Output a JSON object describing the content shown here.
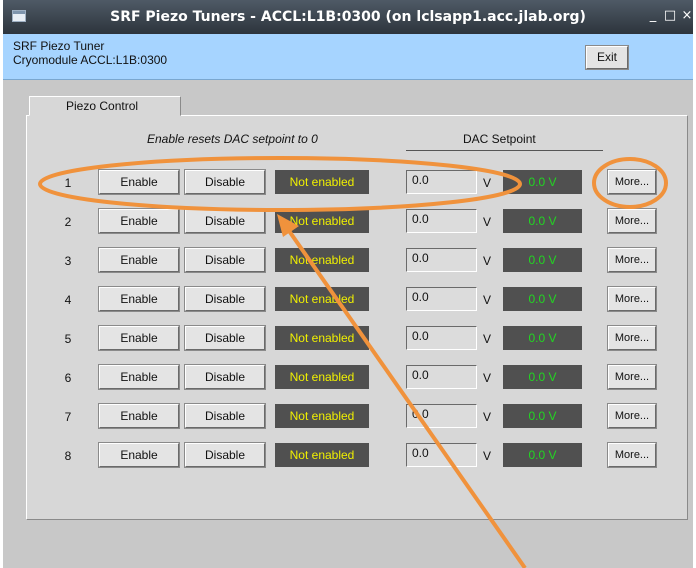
{
  "window": {
    "title": "SRF Piezo Tuners - ACCL:L1B:0300 (on lclsapp1.acc.jlab.org)",
    "minimize": "_",
    "maximize": "□",
    "close": "×"
  },
  "header": {
    "line1": "SRF Piezo Tuner",
    "line2": "Cryomodule ACCL:L1B:0300",
    "exit_label": "Exit"
  },
  "tab": {
    "label": "Piezo Control"
  },
  "panel": {
    "enable_note": "Enable resets DAC setpoint to 0",
    "dac_header": "DAC Setpoint"
  },
  "rows": [
    {
      "num": "1",
      "enable": "Enable",
      "disable": "Disable",
      "status": "Not enabled",
      "setpoint": "0.0",
      "unit": "V",
      "readback": "0.0 V",
      "more": "More..."
    },
    {
      "num": "2",
      "enable": "Enable",
      "disable": "Disable",
      "status": "Not enabled",
      "setpoint": "0.0",
      "unit": "V",
      "readback": "0.0 V",
      "more": "More..."
    },
    {
      "num": "3",
      "enable": "Enable",
      "disable": "Disable",
      "status": "Not enabled",
      "setpoint": "0.0",
      "unit": "V",
      "readback": "0.0 V",
      "more": "More..."
    },
    {
      "num": "4",
      "enable": "Enable",
      "disable": "Disable",
      "status": "Not enabled",
      "setpoint": "0.0",
      "unit": "V",
      "readback": "0.0 V",
      "more": "More..."
    },
    {
      "num": "5",
      "enable": "Enable",
      "disable": "Disable",
      "status": "Not enabled",
      "setpoint": "0.0",
      "unit": "V",
      "readback": "0.0 V",
      "more": "More..."
    },
    {
      "num": "6",
      "enable": "Enable",
      "disable": "Disable",
      "status": "Not enabled",
      "setpoint": "0.0",
      "unit": "V",
      "readback": "0.0 V",
      "more": "More..."
    },
    {
      "num": "7",
      "enable": "Enable",
      "disable": "Disable",
      "status": "Not enabled",
      "setpoint": "0.0",
      "unit": "V",
      "readback": "0.0 V",
      "more": "More..."
    },
    {
      "num": "8",
      "enable": "Enable",
      "disable": "Disable",
      "status": "Not enabled",
      "setpoint": "0.0",
      "unit": "V",
      "readback": "0.0 V",
      "more": "More..."
    }
  ],
  "colors": {
    "titlebar": "#3a424b",
    "header_bg": "#a6d4ff",
    "status_bg": "#505050",
    "status_text": "#f0f000",
    "readback_text": "#22d622",
    "annotation": "#f0923c"
  }
}
